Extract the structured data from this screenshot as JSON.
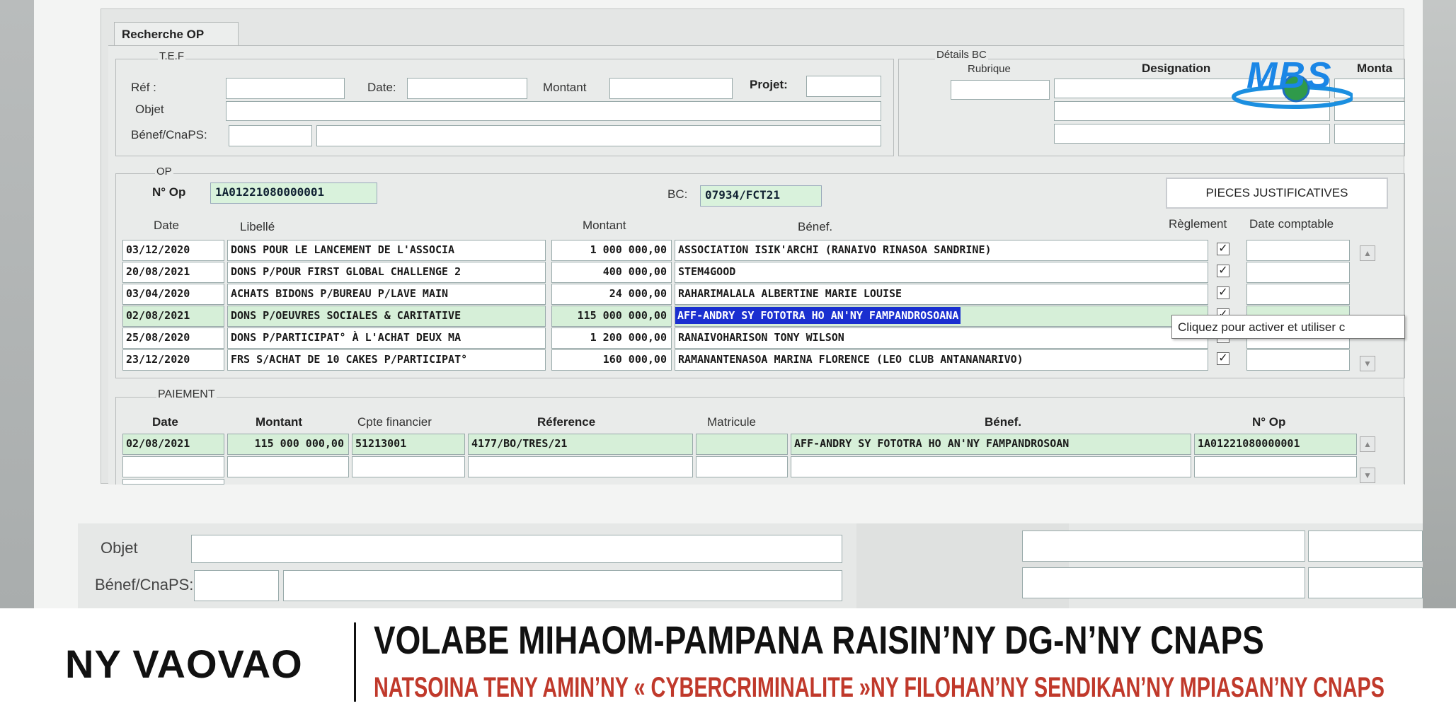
{
  "window": {
    "tab_label": "Recherche OP"
  },
  "tef": {
    "group_label": "T.E.F",
    "ref_label": "Réf :",
    "date_label": "Date:",
    "montant_label": "Montant",
    "projet_label": "Projet:",
    "objet_label": "Objet",
    "benef_label": "Bénef/CnaPS:"
  },
  "details_bc": {
    "group_label": "Détails BC",
    "rubrique_label": "Rubrique",
    "designation_label": "Designation",
    "montant_label": "Monta"
  },
  "logo": {
    "text": "MBS"
  },
  "op": {
    "group_label": "OP",
    "numero_label": "N° Op",
    "numero_value": "1A01221080000001",
    "bc_label": "BC:",
    "bc_value": "07934/FCT21",
    "pieces_button": "PIECES JUSTIFICATIVES",
    "columns": [
      "Date",
      "Libellé",
      "Montant",
      "Bénef.",
      "Règlement",
      "Date comptable"
    ],
    "rows": [
      {
        "date": "03/12/2020",
        "libelle": "DONS POUR LE LANCEMENT DE L'ASSOCIA",
        "montant": "1 000 000,00",
        "benef": "ASSOCIATION ISIK'ARCHI (RANAIVO RINASOA SANDRINE)",
        "reglement": "✓"
      },
      {
        "date": "20/08/2021",
        "libelle": "DONS P/POUR FIRST GLOBAL CHALLENGE 2",
        "montant": "400 000,00",
        "benef": "STEM4GOOD",
        "reglement": "✓"
      },
      {
        "date": "03/04/2020",
        "libelle": "ACHATS BIDONS P/BUREAU P/LAVE MAIN",
        "montant": "24 000,00",
        "benef": "RAHARIMALALA ALBERTINE MARIE LOUISE",
        "reglement": "✓"
      },
      {
        "date": "02/08/2021",
        "libelle": "DONS P/OEUVRES SOCIALES & CARITATIVE",
        "montant": "115 000 000,00",
        "benef": "AFF-ANDRY SY FOTOTRA HO AN'NY FAMPANDROSOANA",
        "reglement": "✓"
      },
      {
        "date": "25/08/2020",
        "libelle": "DONS P/PARTICIPAT° À L'ACHAT DEUX MA",
        "montant": "1 200 000,00",
        "benef": "RANAIVOHARISON TONY WILSON",
        "reglement": ""
      },
      {
        "date": "23/12/2020",
        "libelle": "FRS S/ACHAT DE 10 CAKES P/PARTICIPAT°",
        "montant": "160 000,00",
        "benef": "RAMANANTENASOA MARINA FLORENCE (LEO CLUB ANTANANARIVO)",
        "reglement": "✓"
      }
    ],
    "tooltip": "Cliquez pour activer et utiliser c"
  },
  "paiement": {
    "group_label": "PAIEMENT",
    "columns": [
      "Date",
      "Montant",
      "Cpte financier",
      "Réference",
      "Matricule",
      "Bénef.",
      "N° Op"
    ],
    "row": {
      "date": "02/08/2021",
      "montant": "115 000 000,00",
      "cpte": "51213001",
      "reference": "4177/BO/TRES/21",
      "matricule": "",
      "benef": "AFF-ANDRY SY FOTOTRA HO AN'NY FAMPANDROSOAN",
      "numero": "1A01221080000001"
    }
  },
  "lower_form": {
    "objet_label": "Objet",
    "benef_label": "Bénef/CnaPS:"
  },
  "news": {
    "brand": "NY VAOVAO",
    "headline": "VOLABE MIHAOM-PAMPANA RAISIN’NY DG-N’NY CNAPS",
    "subheadline": "NATSOINA TENY AMIN’NY « CYBERCRIMINALITE »NY FILOHAN’NY SENDIKAN’NY MPIASAN’NY CNAPS",
    "subheadline_color": "#c0392b"
  }
}
